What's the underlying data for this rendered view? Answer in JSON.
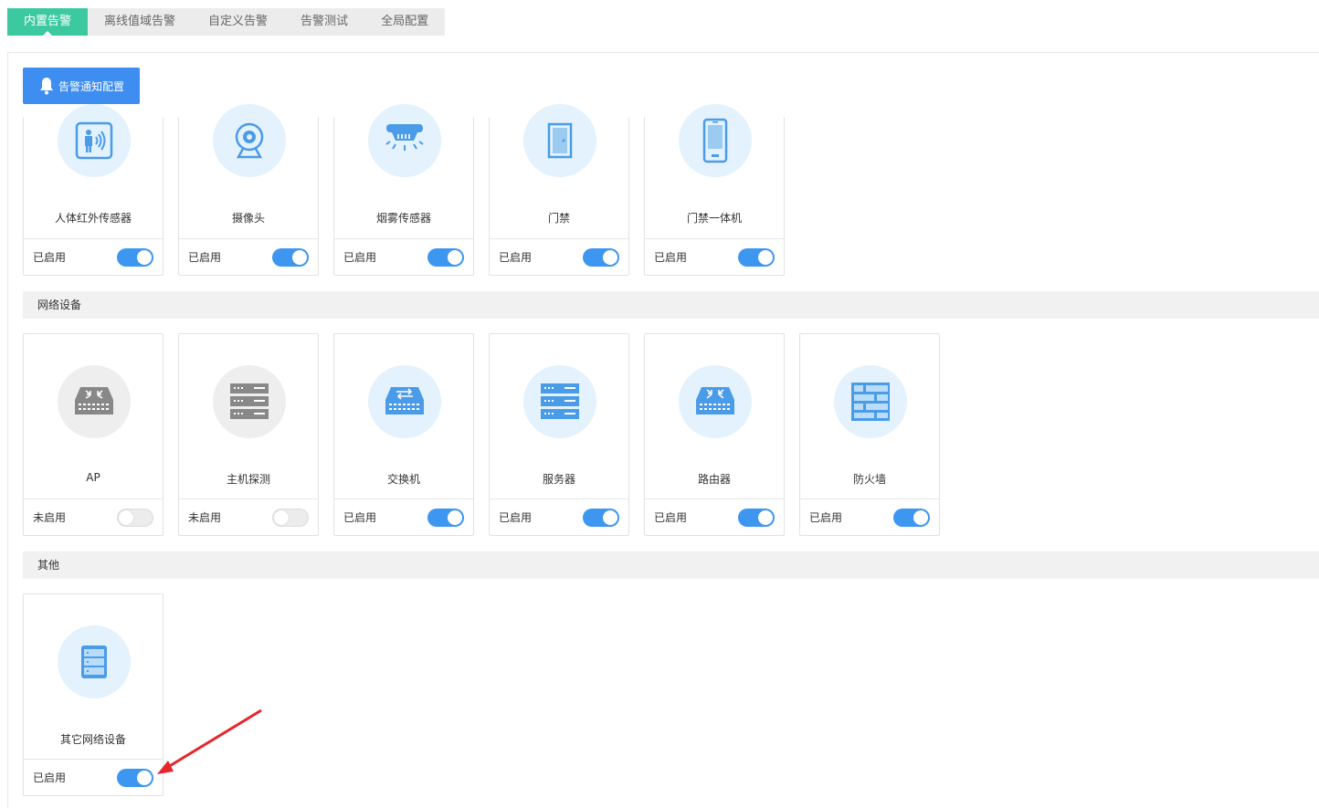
{
  "tabs": [
    "内置告警",
    "离线值域告警",
    "自定义告警",
    "告警测试",
    "全局配置"
  ],
  "notify_button": "告警通知配置",
  "sections": {
    "network": "网络设备",
    "other": "其他"
  },
  "devices_top": [
    {
      "name": "人体红外传感器",
      "status": "已启用",
      "icon": "infrared-sensor-icon"
    },
    {
      "name": "摄像头",
      "status": "已启用",
      "icon": "camera-icon"
    },
    {
      "name": "烟雾传感器",
      "status": "已启用",
      "icon": "smoke-detector-icon"
    },
    {
      "name": "门禁",
      "status": "已启用",
      "icon": "door-icon"
    },
    {
      "name": "门禁一体机",
      "status": "已启用",
      "icon": "access-terminal-icon"
    }
  ],
  "devices_network": [
    {
      "name": "AP",
      "status": "未启用",
      "icon": "ap-icon"
    },
    {
      "name": "主机探测",
      "status": "未启用",
      "icon": "host-probe-icon"
    },
    {
      "name": "交换机",
      "status": "已启用",
      "icon": "switch-icon"
    },
    {
      "name": "服务器",
      "status": "已启用",
      "icon": "server-icon"
    },
    {
      "name": "路由器",
      "status": "已启用",
      "icon": "router-icon"
    },
    {
      "name": "防火墙",
      "status": "已启用",
      "icon": "firewall-icon"
    }
  ],
  "devices_other": [
    {
      "name": "其它网络设备",
      "status": "已启用",
      "icon": "other-network-device-icon"
    }
  ],
  "colors": {
    "tab_active": "#3dc9a0",
    "primary": "#3d8ef0",
    "icon_blue": "#4a9be8",
    "annotation": "#e5262b"
  }
}
